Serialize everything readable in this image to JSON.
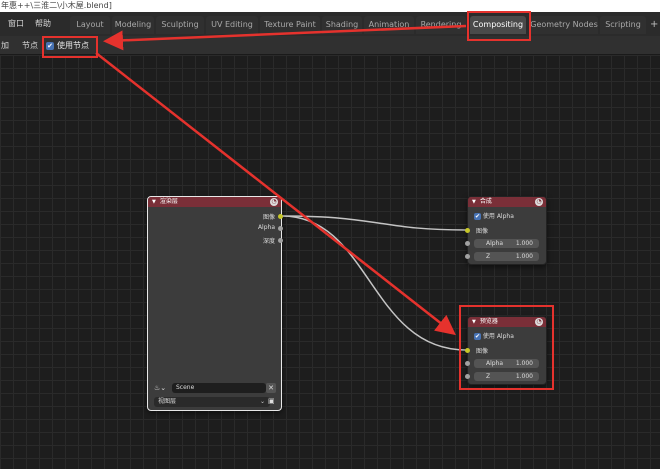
{
  "title_bar": "年惠++\\三淮二\\小木屋.blend]",
  "menu": {
    "window": "窗口",
    "help": "帮助"
  },
  "tabs": [
    {
      "label": "Layout",
      "active": false
    },
    {
      "label": "Modeling",
      "active": false
    },
    {
      "label": "Sculpting",
      "active": false
    },
    {
      "label": "UV Editing",
      "active": false
    },
    {
      "label": "Texture Paint",
      "active": false
    },
    {
      "label": "Shading",
      "active": false
    },
    {
      "label": "Animation",
      "active": false
    },
    {
      "label": "Rendering",
      "active": false
    },
    {
      "label": "Compositing",
      "active": true
    },
    {
      "label": "Geometry Nodes",
      "active": false
    },
    {
      "label": "Scripting",
      "active": false
    }
  ],
  "add_tab": "+",
  "header": {
    "add": "加",
    "node": "节点",
    "use_nodes": "使用节点",
    "use_nodes_checked": true
  },
  "render_layers_node": {
    "title": "渲染层",
    "outputs": [
      "图像",
      "Alpha",
      "深度"
    ],
    "scene": "Scene",
    "view_layer": "视图层"
  },
  "composite_node": {
    "title": "合成",
    "use_alpha": "使用 Alpha",
    "image": "图像",
    "alpha_label": "Alpha",
    "alpha_value": "1.000",
    "z_label": "Z",
    "z_value": "1.000"
  },
  "viewer_node": {
    "title": "预览器",
    "use_alpha": "使用 Alpha",
    "image": "图像",
    "alpha_label": "Alpha",
    "alpha_value": "1.000",
    "z_label": "Z",
    "z_value": "1.000"
  },
  "colors": {
    "node_header": "#7a2f38",
    "socket_image": "#c7c729",
    "socket_value": "#a1a1a1",
    "annotation_red": "#e5322d",
    "active_tab": "#4a4a4a"
  }
}
